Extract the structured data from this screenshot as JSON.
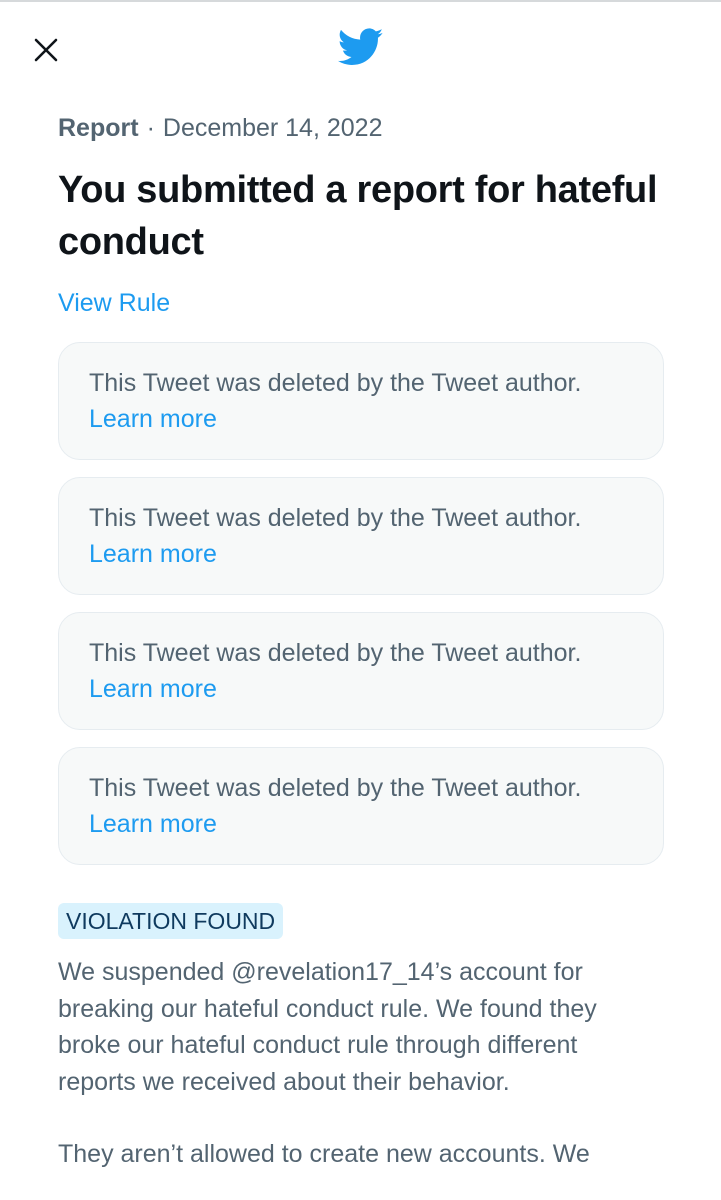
{
  "header": {
    "close_icon": "close-icon",
    "logo_icon": "twitter-bird-logo",
    "brand_color": "#1d9bf0"
  },
  "report": {
    "kind": "Report",
    "separator": "·",
    "date": "December 14, 2022",
    "title": "You submitted a report for hateful conduct",
    "view_rule_label": "View Rule"
  },
  "deleted_tweets": [
    {
      "text": "This Tweet was deleted by the Tweet author.",
      "link": "Learn more"
    },
    {
      "text": "This Tweet was deleted by the Tweet author.",
      "link": "Learn more"
    },
    {
      "text": "This Tweet was deleted by the Tweet author.",
      "link": "Learn more"
    },
    {
      "text": "This Tweet was deleted by the Tweet author.",
      "link": "Learn more"
    }
  ],
  "outcome": {
    "badge": "VIOLATION FOUND",
    "paragraph_1": "We suspended @revelation17_14’s account for breaking our hateful conduct rule. We found they broke our hateful conduct rule through different reports we received about their behavior.",
    "paragraph_2": "They aren’t allowed to create new accounts. We"
  }
}
